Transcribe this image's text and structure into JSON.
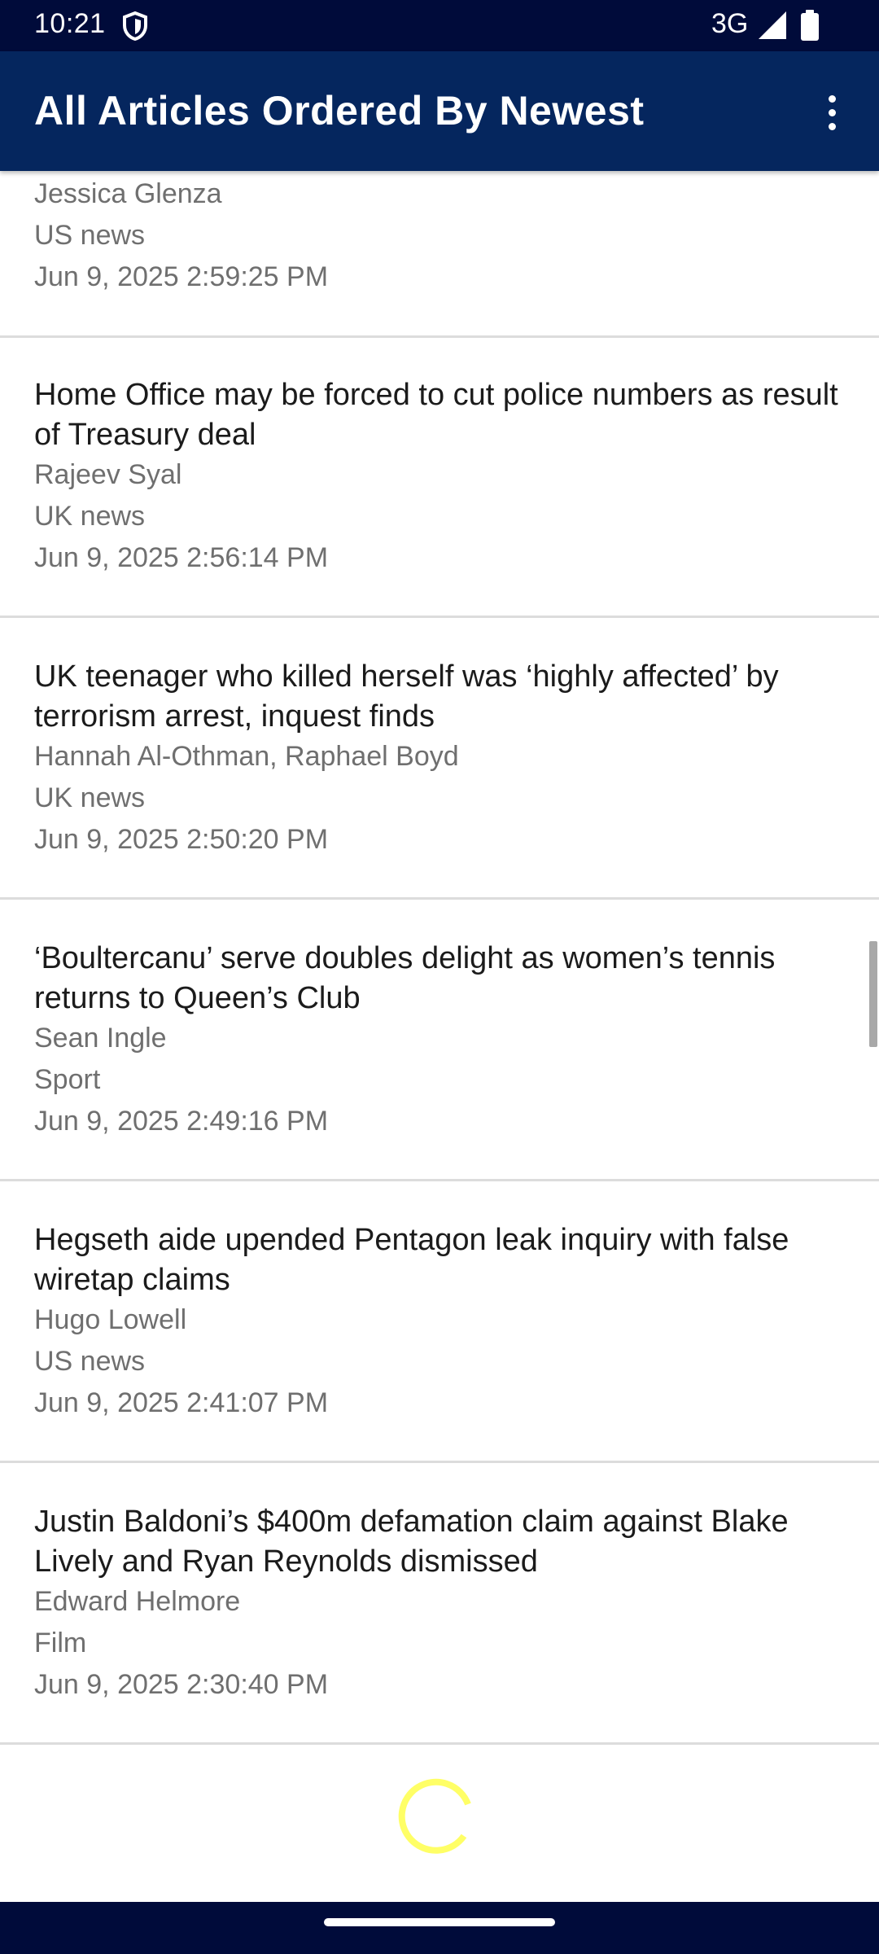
{
  "status_bar": {
    "time": "10:21",
    "network": "3G",
    "icons": [
      "shield-icon",
      "signal-icon",
      "battery-icon"
    ]
  },
  "app_bar": {
    "title": "All Articles Ordered By Newest",
    "menu_icon": "overflow-menu-icon"
  },
  "articles": [
    {
      "title": "",
      "author": "Jessica Glenza",
      "section": "US news",
      "date": "Jun 9, 2025 2:59:25 PM"
    },
    {
      "title": "Home Office may be forced to cut police numbers as result of Treasury deal",
      "author": "Rajeev Syal",
      "section": "UK news",
      "date": "Jun 9, 2025 2:56:14 PM"
    },
    {
      "title": "UK teenager who killed herself was ‘highly affected’ by terrorism arrest, inquest finds",
      "author": "Hannah Al-Othman, Raphael Boyd",
      "section": "UK news",
      "date": "Jun 9, 2025 2:50:20 PM"
    },
    {
      "title": "‘Boultercanu’ serve doubles delight as women’s tennis returns to Queen’s Club",
      "author": "Sean Ingle",
      "section": "Sport",
      "date": "Jun 9, 2025 2:49:16 PM"
    },
    {
      "title": "Hegseth aide upended Pentagon leak inquiry with false wiretap claims",
      "author": "Hugo Lowell",
      "section": "US news",
      "date": "Jun 9, 2025 2:41:07 PM"
    },
    {
      "title": "Justin Baldoni’s $400m defamation claim against Blake Lively and Ryan Reynolds dismissed",
      "author": "Edward Helmore",
      "section": "Film",
      "date": "Jun 9, 2025 2:30:40 PM"
    }
  ],
  "colors": {
    "status_bar": "#000b3a",
    "app_bar": "#05265e",
    "spinner": "#ffff66",
    "divider": "#dcdcdc"
  },
  "loading": {
    "icon": "loading-spinner-icon"
  }
}
